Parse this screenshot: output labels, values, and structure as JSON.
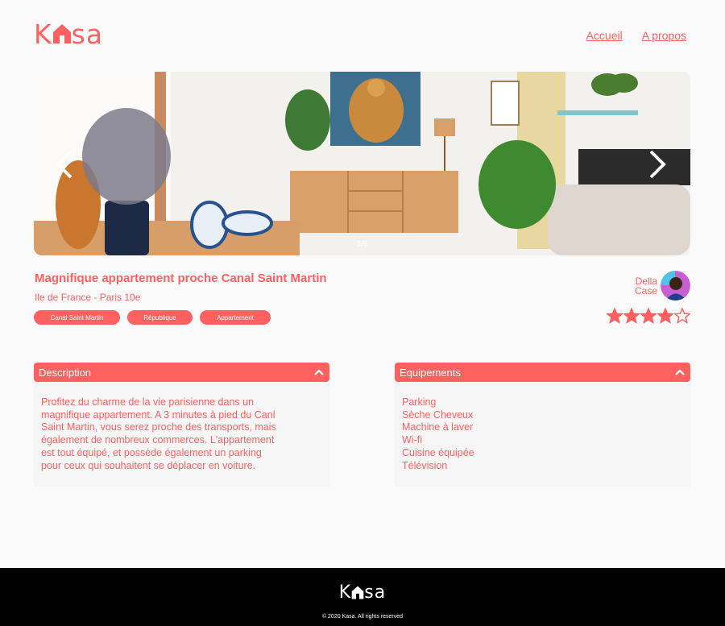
{
  "brand": {
    "logo_part1": "K",
    "logo_part2": "sa",
    "accent_color": "#ff6060"
  },
  "nav": {
    "home": "Accueil",
    "about": "A propos"
  },
  "gallery": {
    "counter": "3/6",
    "prev_icon": "chevron-left-icon",
    "next_icon": "chevron-right-icon"
  },
  "listing": {
    "title": "Magnifique appartement proche Canal Saint Martin",
    "location": "Ile de France - Paris 10e",
    "tags": [
      "Canal Saint Martin",
      "République",
      "Appartement"
    ],
    "rating": 4,
    "rating_max": 5
  },
  "host": {
    "first_name": "Della",
    "last_name": "Case"
  },
  "description": {
    "title": "Description",
    "lines": [
      "Profitez du charme de la vie parisienne dans un",
      "magnifique appartement. A 3 minutes à pied du Canl",
      "Saint Martin, vous serez proche des transports, mais",
      "également de nombreux commerces. L'appartement",
      "est tout équipé, et possède également un parking",
      "pour ceux qui souhaitent se déplacer en voiture."
    ]
  },
  "equipments": {
    "title": "Equipements",
    "items": [
      "Parking",
      "Sèche Cheveux",
      "Machine à laver",
      "Wi-fi",
      "Cuisine équipée",
      "Télévision"
    ]
  },
  "footer": {
    "logo_part1": "K",
    "logo_part2": "sa",
    "copyright": "© 2020 Kasa. All rights reserved"
  }
}
